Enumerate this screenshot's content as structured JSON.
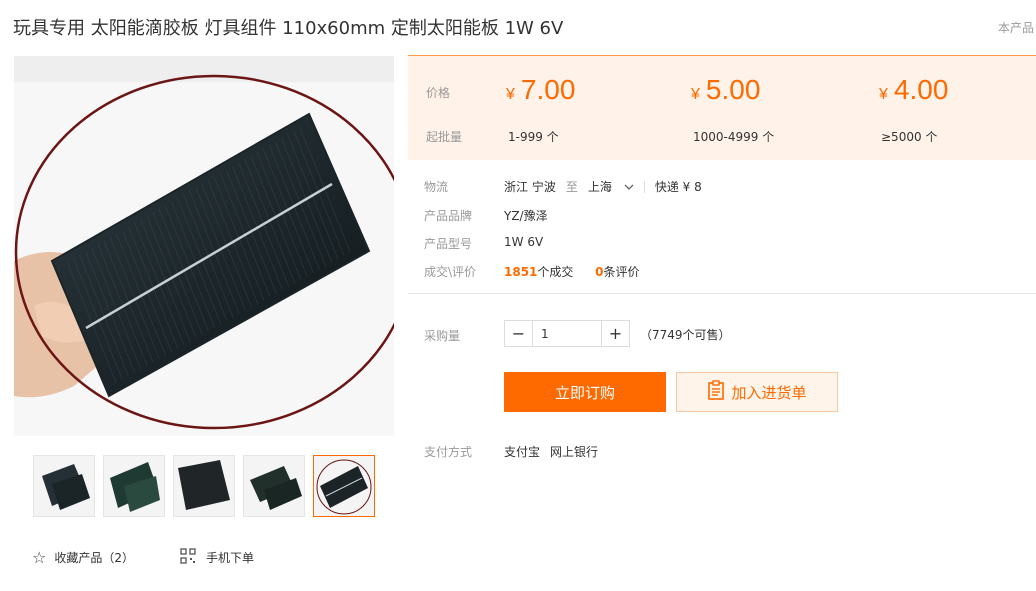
{
  "title": "玩具专用 太阳能滴胶板 灯具组件 110x60mm 定制太阳能板 1W 6V",
  "top_right_text": "本产品",
  "price_panel": {
    "price_label": "价格",
    "moq_label": "起批量",
    "currency": "¥",
    "tiers": [
      {
        "price": "7.00",
        "range": "1-999 个"
      },
      {
        "price": "5.00",
        "range": "1000-4999 个"
      },
      {
        "price": "4.00",
        "range": "≥5000 个"
      }
    ]
  },
  "logistics": {
    "label": "物流",
    "from": "浙江 宁波",
    "to_word": "至",
    "to": "上海",
    "shipping": "快递 ¥ 8"
  },
  "brand": {
    "label": "产品品牌",
    "value": "YZ/豫泽"
  },
  "model": {
    "label": "产品型号",
    "value": "1W 6V"
  },
  "deals": {
    "label": "成交\\评价",
    "sold": "1851",
    "sold_unit": "个成交",
    "reviews": "0",
    "reviews_unit": "条评价"
  },
  "purchase": {
    "label": "采购量",
    "quantity": "1",
    "stock": "（7749个可售）"
  },
  "buttons": {
    "buy": "立即订购",
    "cart": "加入进货单"
  },
  "payment": {
    "label": "支付方式",
    "methods": [
      "支付宝",
      "网上银行"
    ]
  },
  "actions": {
    "favorite": "收藏产品（2）",
    "mobile": "手机下单"
  },
  "colors": {
    "accent": "#ff6a00",
    "price_bg": "#fff2e8"
  },
  "icons": [
    "star-icon",
    "qr-code-icon",
    "chevron-down-icon",
    "clipboard-icon",
    "minus-icon",
    "plus-icon"
  ]
}
